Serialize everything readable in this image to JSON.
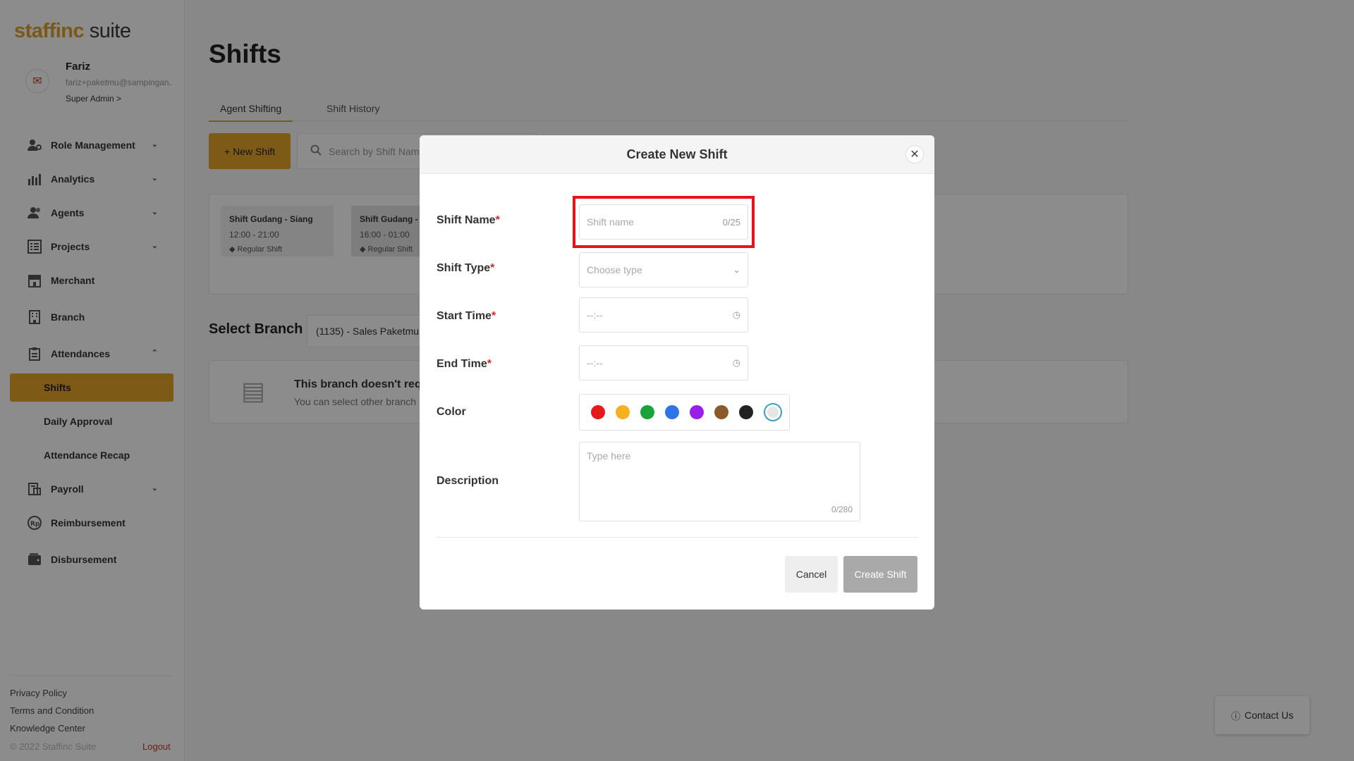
{
  "brand": {
    "part1": "staffinc",
    "part2": " suite"
  },
  "user": {
    "name": "Fariz",
    "email": "fariz+paketmu@sampingan.",
    "role": "Super Admin >"
  },
  "nav": {
    "role_management": "Role Management",
    "analytics": "Analytics",
    "agents": "Agents",
    "projects": "Projects",
    "merchant": "Merchant",
    "branch": "Branch",
    "attendances": "Attendances",
    "shifts": "Shifts",
    "daily_approval": "Daily Approval",
    "attendance_recap": "Attendance Recap",
    "payroll": "Payroll",
    "reimbursement": "Reimbursement",
    "disbursement": "Disbursement"
  },
  "footer": {
    "privacy": "Privacy Policy",
    "terms": "Terms and Condition",
    "knowledge": "Knowledge Center",
    "copyright": "© 2022 Staffinc Suite",
    "logout": "Logout"
  },
  "page": {
    "title": "Shifts",
    "tabs": [
      "Agent Shifting",
      "Shift History"
    ],
    "new_shift": "+ New Shift",
    "search_placeholder": "Search by Shift Name",
    "shift_cards": [
      {
        "name": "Shift Gudang - Siang",
        "time": "12:00 - 21:00",
        "tag": "Regular Shift"
      },
      {
        "name": "Shift Gudang - S",
        "time": "16:00 - 01:00",
        "tag": "Regular Shift"
      }
    ],
    "select_branch": "Select Branch",
    "branch_value": "(1135) - Sales Paketmu",
    "empty_title": "This branch doesn't requ",
    "empty_sub": "You can select other branch",
    "contact": "Contact Us"
  },
  "modal": {
    "title": "Create New Shift",
    "shift_name_label": "Shift Name",
    "shift_name_placeholder": "Shift name",
    "shift_name_count": "0/25",
    "shift_type_label": "Shift Type",
    "shift_type_placeholder": "Choose type",
    "start_time_label": "Start Time",
    "start_time_placeholder": "--:--",
    "end_time_label": "End Time",
    "end_time_placeholder": "--:--",
    "color_label": "Color",
    "colors": [
      "#e51b1b",
      "#f5b020",
      "#1aa33a",
      "#2f73e8",
      "#9b1ee8",
      "#8a5a2b",
      "#222222",
      "#e6e6e6"
    ],
    "description_label": "Description",
    "description_placeholder": "Type here",
    "description_count": "0/280",
    "required_mark": "*",
    "cancel": "Cancel",
    "create": "Create Shift"
  }
}
